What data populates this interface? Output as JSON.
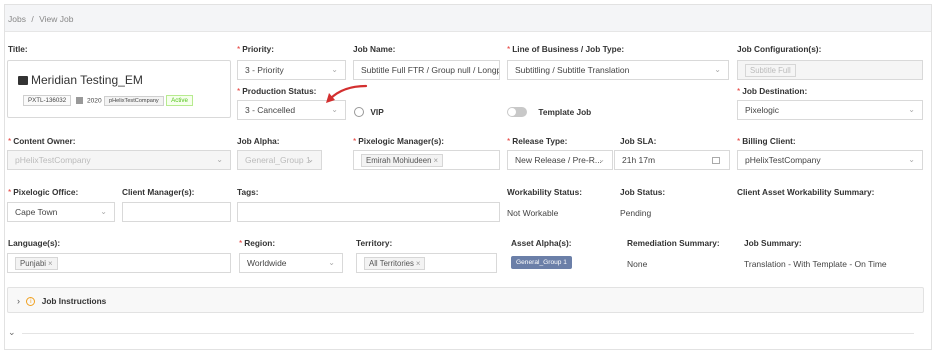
{
  "breadcrumb": {
    "parent": "Jobs",
    "separator": "/",
    "current": "View Job"
  },
  "labels": {
    "title": "Title:",
    "priority": "Priority:",
    "job_name": "Job Name:",
    "line_of_business": "Line of Business / Job Type:",
    "job_configuration": "Job Configuration(s):",
    "production_status": "Production Status:",
    "vip": "VIP",
    "template_job": "Template Job",
    "job_destination": "Job Destination:",
    "content_owner": "Content Owner:",
    "job_alpha": "Job Alpha:",
    "pixelogic_manager": "Pixelogic Manager(s):",
    "release_type": "Release Type:",
    "job_sla": "Job SLA:",
    "billing_client": "Billing Client:",
    "pixelogic_office": "Pixelogic Office:",
    "client_manager": "Client Manager(s):",
    "tags": "Tags:",
    "workability_status": "Workability Status:",
    "job_status": "Job Status:",
    "client_asset_workability": "Client Asset Workability Summary:",
    "languages": "Language(s):",
    "region": "Region:",
    "territory": "Territory:",
    "asset_alpha": "Asset Alpha(s):",
    "remediation_summary": "Remediation Summary:",
    "job_summary": "Job Summary:"
  },
  "title_card": {
    "title": "Meridian Testing_EM",
    "code": "PXTL-136032",
    "year": "2020",
    "company": "pHelixTestCompany",
    "status": "Active"
  },
  "values": {
    "priority": "3 - Priority",
    "job_name": "Subtitle Full FTR / Group null / Longp",
    "line_of_business": "Subtitling / Subtitle Translation",
    "job_configuration": "Subtitle Full",
    "production_status": "3 - Cancelled",
    "job_destination": "Pixelogic",
    "content_owner": "pHelixTestCompany",
    "job_alpha": "General_Group 1",
    "pixelogic_manager": "Emirah Mohiudeen",
    "release_type": "New Release / Pre-R...",
    "job_sla": "21h 17m",
    "billing_client": "pHelixTestCompany",
    "pixelogic_office": "Cape Town",
    "client_manager": "",
    "tags": "",
    "workability_status": "Not Workable",
    "job_status": "Pending",
    "client_asset_workability": "",
    "language": "Punjabi",
    "region": "Worldwide",
    "territory": "All Territories",
    "asset_alpha": "General_Group 1",
    "remediation_summary": "None",
    "job_summary": "Translation - With Template - On Time"
  },
  "sections": {
    "job_instructions": "Job Instructions"
  },
  "icons": {
    "chevron": "chevron-down-icon",
    "calendar": "calendar-icon",
    "info": "info-icon",
    "film": "film-icon"
  },
  "colors": {
    "required": "#e53935",
    "active_green": "#52c41a",
    "annotation_arrow": "#d32f2f",
    "asset_badge": "#6b7fa8"
  }
}
